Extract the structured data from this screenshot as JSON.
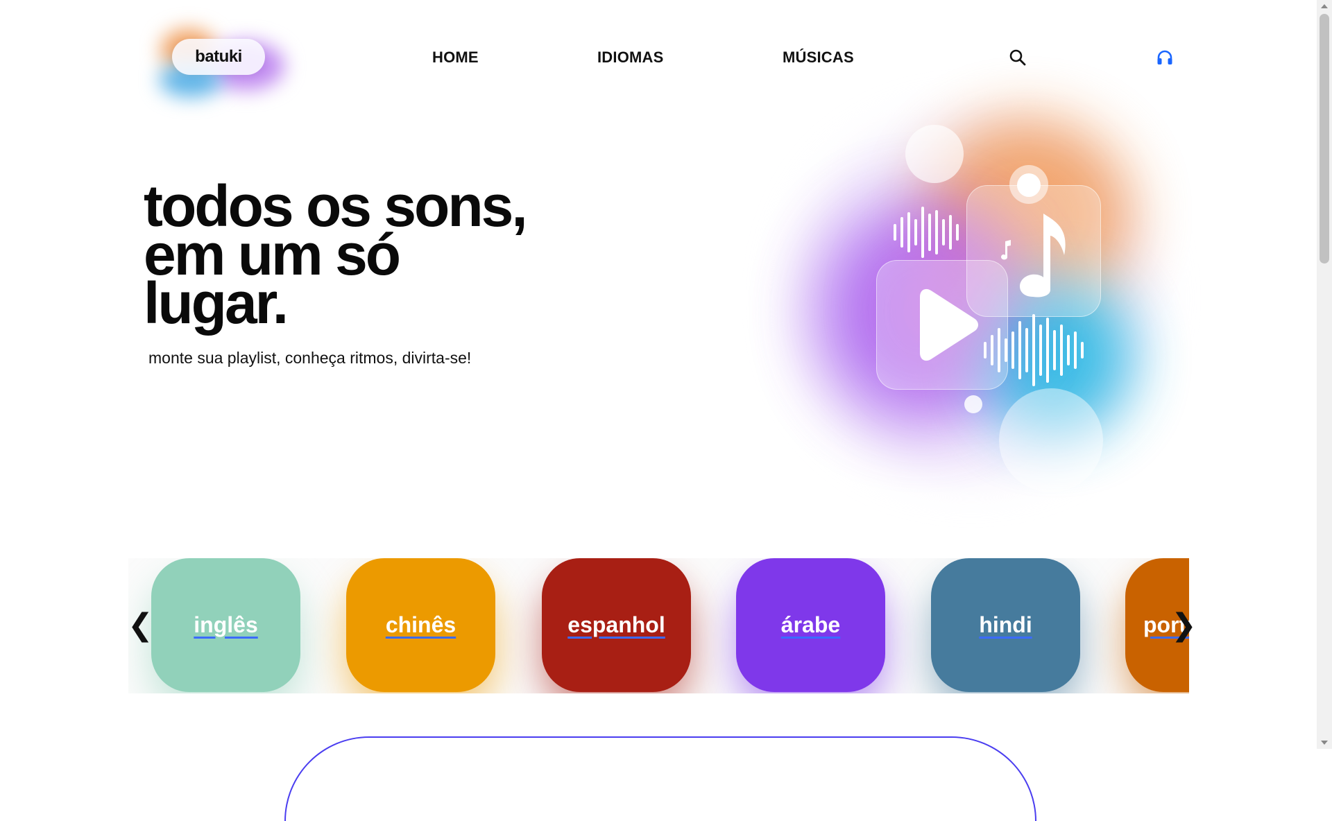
{
  "header": {
    "logo": "batuki",
    "nav": [
      "HOME",
      "IDIOMAS",
      "MÚSICAS"
    ],
    "icons": [
      "search-icon",
      "headphones-icon"
    ],
    "headphones_color": "#1a66ff"
  },
  "hero": {
    "title_lines": [
      "todos os sons,",
      "em um só",
      "lugar."
    ],
    "subtitle": "monte sua playlist, conheça ritmos, divirta-se!"
  },
  "languages": {
    "items": [
      {
        "label": "inglês",
        "color": "#91d1ba"
      },
      {
        "label": "chinês",
        "color": "#ec9a00"
      },
      {
        "label": "espanhol",
        "color": "#a81f14"
      },
      {
        "label": "árabe",
        "color": "#7f38ea"
      },
      {
        "label": "hindi",
        "color": "#467b9d"
      },
      {
        "label": "português",
        "color": "#c96200"
      }
    ],
    "prev_icon": "chevron-left-icon",
    "next_icon": "chevron-right-icon"
  }
}
